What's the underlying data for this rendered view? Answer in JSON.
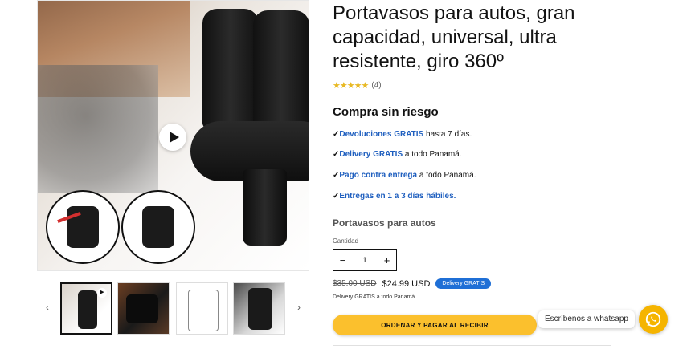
{
  "product": {
    "title": "Portavasos para autos, gran capacidad, universal, ultra resistente, giro 360º",
    "rating_stars": "★★★★★",
    "review_count": "(4)"
  },
  "guarantee": {
    "heading": "Compra sin riesgo",
    "items": [
      {
        "check": "✓",
        "highlight": "Devoluciones GRATIS",
        "rest": " hasta 7 días."
      },
      {
        "check": "✓",
        "highlight": "Delivery GRATIS",
        "rest": " a todo Panamá."
      },
      {
        "check": "✓",
        "highlight": "Pago contra entrega",
        "rest": " a todo Panamá."
      },
      {
        "check": "✓",
        "highlight": "Entregas en 1 a 3 días hábiles.",
        "rest": ""
      }
    ]
  },
  "variant_label": "Portavasos para autos",
  "quantity": {
    "label": "Cantidad",
    "value": "1",
    "minus": "−",
    "plus": "+"
  },
  "price": {
    "old": "$35.00 USD",
    "new": "$24.99 USD",
    "badge": "Delivery GRATIS",
    "note": "Delivery GRATIS a todo Panamá"
  },
  "cta_label": "ORDENAR Y PAGAR AL RECIBIR",
  "gallery": {
    "prev": "‹",
    "next": "›",
    "thumb_play": "▶"
  },
  "whatsapp": {
    "label": "Escríbenos a whatsapp"
  },
  "colors": {
    "accent_blue": "#1f5fbf",
    "cta_yellow": "#fbc02d",
    "badge_blue": "#1f6fd6",
    "star_gold": "#e8b923"
  }
}
